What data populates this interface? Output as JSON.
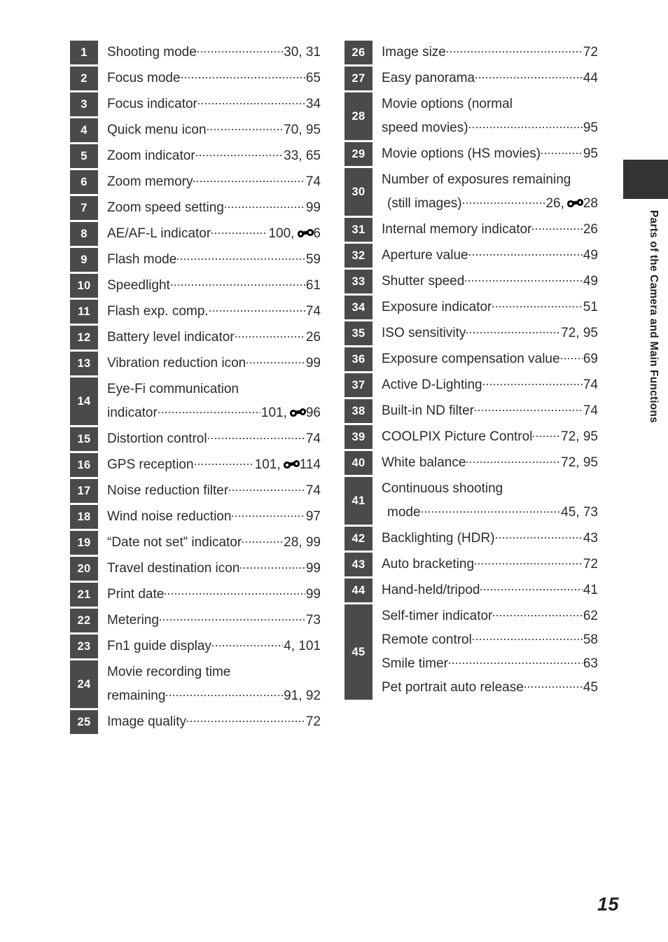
{
  "page": {
    "number": "15",
    "side_tab_label": "Parts of the Camera and Main Functions"
  },
  "icons": {
    "reference_section": "reference-section-icon"
  },
  "left_column": [
    {
      "badge": "1",
      "lines": [
        {
          "label": "Shooting mode",
          "page": "30, 31"
        }
      ]
    },
    {
      "badge": "2",
      "lines": [
        {
          "label": "Focus mode",
          "page": "65"
        }
      ]
    },
    {
      "badge": "3",
      "lines": [
        {
          "label": "Focus indicator",
          "page": "34"
        }
      ]
    },
    {
      "badge": "4",
      "lines": [
        {
          "label": "Quick menu icon",
          "page": "70, 95"
        }
      ]
    },
    {
      "badge": "5",
      "lines": [
        {
          "label": "Zoom indicator",
          "page": "33, 65"
        }
      ]
    },
    {
      "badge": "6",
      "lines": [
        {
          "label": "Zoom memory",
          "page": "74"
        }
      ]
    },
    {
      "badge": "7",
      "lines": [
        {
          "label": "Zoom speed setting",
          "page": "99"
        }
      ]
    },
    {
      "badge": "8",
      "lines": [
        {
          "label": "AE/AF-L indicator",
          "page": "100,",
          "ref": true,
          "ref_page": "6"
        }
      ]
    },
    {
      "badge": "9",
      "lines": [
        {
          "label": "Flash mode",
          "page": "59"
        }
      ]
    },
    {
      "badge": "10",
      "lines": [
        {
          "label": "Speedlight",
          "page": "61"
        }
      ]
    },
    {
      "badge": "11",
      "lines": [
        {
          "label": "Flash exp. comp.",
          "page": "74"
        }
      ]
    },
    {
      "badge": "12",
      "lines": [
        {
          "label": "Battery level indicator",
          "page": "26"
        }
      ]
    },
    {
      "badge": "13",
      "lines": [
        {
          "label": "Vibration reduction icon",
          "page": "99"
        }
      ]
    },
    {
      "badge": "14",
      "lines": [
        {
          "label": "Eye-Fi communication",
          "page": ""
        },
        {
          "label": "indicator",
          "page": "101,",
          "ref": true,
          "ref_page": "96"
        }
      ]
    },
    {
      "badge": "15",
      "lines": [
        {
          "label": "Distortion control",
          "page": "74"
        }
      ]
    },
    {
      "badge": "16",
      "lines": [
        {
          "label": "GPS reception",
          "page": "101,",
          "ref": true,
          "ref_page": "114"
        }
      ]
    },
    {
      "badge": "17",
      "lines": [
        {
          "label": "Noise reduction filter",
          "page": "74"
        }
      ]
    },
    {
      "badge": "18",
      "lines": [
        {
          "label": "Wind noise reduction",
          "page": "97"
        }
      ]
    },
    {
      "badge": "19",
      "lines": [
        {
          "label": "“Date not set” indicator",
          "page": "28, 99"
        }
      ]
    },
    {
      "badge": "20",
      "lines": [
        {
          "label": "Travel destination icon",
          "page": "99"
        }
      ]
    },
    {
      "badge": "21",
      "lines": [
        {
          "label": "Print date",
          "page": "99"
        }
      ]
    },
    {
      "badge": "22",
      "lines": [
        {
          "label": "Metering",
          "page": "73"
        }
      ]
    },
    {
      "badge": "23",
      "lines": [
        {
          "label": "Fn1 guide display",
          "page": "4, 101"
        }
      ]
    },
    {
      "badge": "24",
      "lines": [
        {
          "label": "Movie recording time",
          "page": ""
        },
        {
          "label": "remaining",
          "page": "91, 92"
        }
      ]
    },
    {
      "badge": "25",
      "lines": [
        {
          "label": "Image quality",
          "page": "72"
        }
      ]
    }
  ],
  "right_column": [
    {
      "badge": "26",
      "lines": [
        {
          "label": "Image size",
          "page": "72"
        }
      ]
    },
    {
      "badge": "27",
      "lines": [
        {
          "label": "Easy panorama",
          "page": "44"
        }
      ]
    },
    {
      "badge": "28",
      "lines": [
        {
          "label": "Movie options (normal",
          "page": ""
        },
        {
          "label": "speed movies)",
          "page": "95"
        }
      ]
    },
    {
      "badge": "29",
      "lines": [
        {
          "label": "Movie options (HS movies)",
          "page": "95"
        }
      ]
    },
    {
      "badge": "30",
      "lines": [
        {
          "label": "Number of exposures remaining",
          "page": ""
        },
        {
          "label": "(still images)",
          "indent": true,
          "page": "26,",
          "ref": true,
          "ref_page": "28"
        }
      ]
    },
    {
      "badge": "31",
      "lines": [
        {
          "label": "Internal memory indicator",
          "page": "26"
        }
      ]
    },
    {
      "badge": "32",
      "lines": [
        {
          "label": "Aperture value",
          "page": "49"
        }
      ]
    },
    {
      "badge": "33",
      "lines": [
        {
          "label": "Shutter speed",
          "page": "49"
        }
      ]
    },
    {
      "badge": "34",
      "lines": [
        {
          "label": "Exposure indicator",
          "page": "51"
        }
      ]
    },
    {
      "badge": "35",
      "lines": [
        {
          "label": "ISO sensitivity",
          "page": "72, 95"
        }
      ]
    },
    {
      "badge": "36",
      "lines": [
        {
          "label": "Exposure compensation value",
          "page": "69"
        }
      ]
    },
    {
      "badge": "37",
      "lines": [
        {
          "label": "Active D-Lighting",
          "page": "74"
        }
      ]
    },
    {
      "badge": "38",
      "lines": [
        {
          "label": "Built-in ND filter",
          "page": "74"
        }
      ]
    },
    {
      "badge": "39",
      "lines": [
        {
          "label": "COOLPIX Picture Control",
          "page": "72, 95"
        }
      ]
    },
    {
      "badge": "40",
      "lines": [
        {
          "label": "White balance",
          "page": "72, 95"
        }
      ]
    },
    {
      "badge": "41",
      "lines": [
        {
          "label": "Continuous shooting",
          "page": ""
        },
        {
          "label": "mode",
          "indent": true,
          "page": "45, 73"
        }
      ]
    },
    {
      "badge": "42",
      "lines": [
        {
          "label": "Backlighting (HDR)",
          "page": "43"
        }
      ]
    },
    {
      "badge": "43",
      "lines": [
        {
          "label": "Auto bracketing",
          "page": "72"
        }
      ]
    },
    {
      "badge": "44",
      "lines": [
        {
          "label": "Hand-held/tripod",
          "page": "41"
        }
      ]
    },
    {
      "badge": "45",
      "lines": [
        {
          "label": "Self-timer indicator",
          "page": "62"
        },
        {
          "label": "Remote control",
          "page": "58"
        },
        {
          "label": "Smile timer",
          "page": "63"
        },
        {
          "label": "Pet portrait auto release",
          "page": "45"
        }
      ]
    }
  ]
}
